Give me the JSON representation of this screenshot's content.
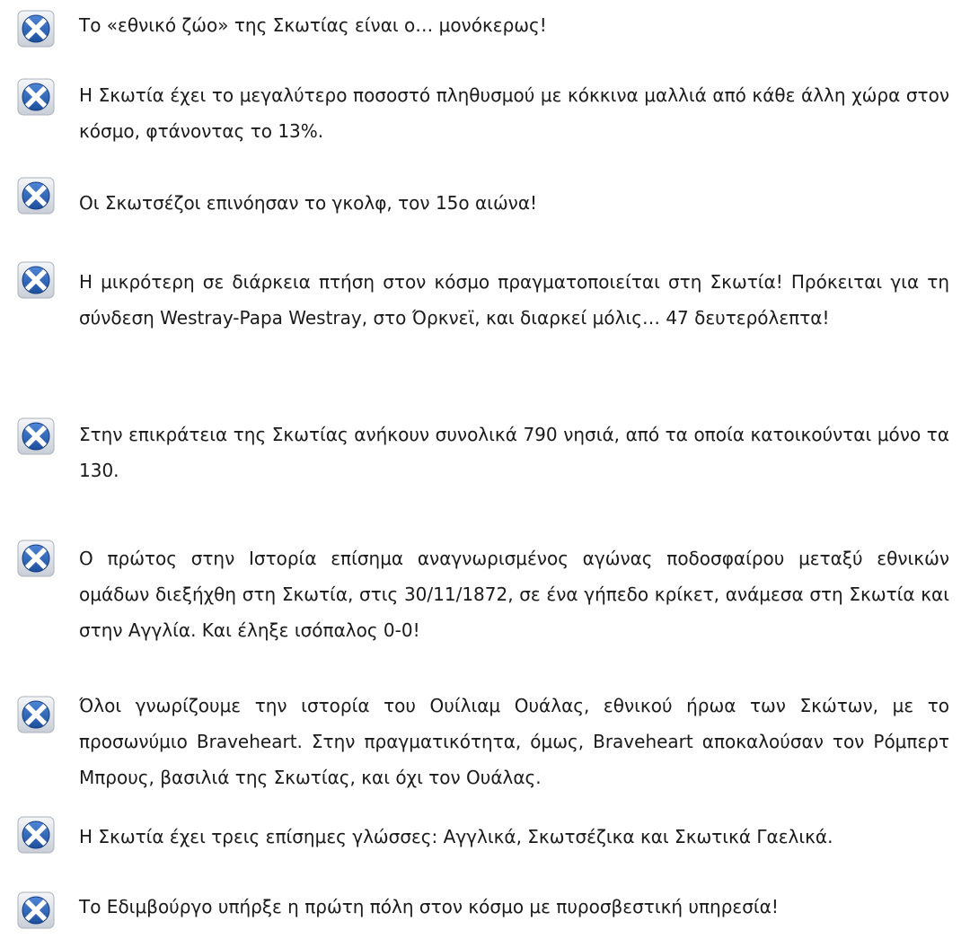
{
  "icons": {
    "bullet": "scottish-flag-icon"
  },
  "colors": {
    "flag_blue": "#2a5fb0",
    "flag_white": "#ffffff",
    "text": "#1a1a1a"
  },
  "facts": [
    "Το «εθνικό ζώο» της Σκωτίας είναι ο… μονόκερως!",
    "Η Σκωτία έχει το μεγαλύτερο ποσοστό πληθυσμού με κόκκινα μαλλιά από κάθε άλλη χώρα στον κόσμο, φτάνοντας το 13%.",
    "Οι Σκωτσέζοι επινόησαν το γκολφ, τον 15ο αιώνα!",
    "Η μικρότερη σε διάρκεια πτήση στον κόσμο πραγματοποιείται στη Σκωτία! Πρόκειται για τη σύνδεση Westray-Papa Westray, στο Όρκνεϊ, και διαρκεί μόλις… 47 δευτερόλεπτα!",
    "Στην επικράτεια της Σκωτίας ανήκουν συνολικά 790 νησιά, από τα οποία κατοικούνται μόνο τα 130.",
    "Ο πρώτος στην Ιστορία επίσημα αναγνωρισμένος αγώνας ποδοσφαίρου μεταξύ εθνικών ομάδων διεξήχθη στη Σκωτία, στις 30/11/1872, σε ένα γήπεδο κρίκετ, ανάμεσα στη Σκωτία και στην Αγγλία. Και έληξε ισόπαλος 0-0!",
    "Όλοι γνωρίζουμε την ιστορία του Ουίλιαμ Ουάλας, εθνικού ήρωα των Σκώτων, με το προσωνύμιο Braveheart. Στην πραγματικότητα, όμως, Braveheart αποκαλούσαν τον Ρόμπερτ Μπρους, βασιλιά της Σκωτίας, και όχι τον Ουάλας.",
    "Η Σκωτία έχει τρεις επίσημες γλώσσες: Αγγλικά, Σκωτσέζικα και Σκωτικά Γαελικά.",
    "Το Εδιμβούργο υπήρξε η πρώτη πόλη στον κόσμο με πυροσβεστική υπηρεσία!"
  ]
}
